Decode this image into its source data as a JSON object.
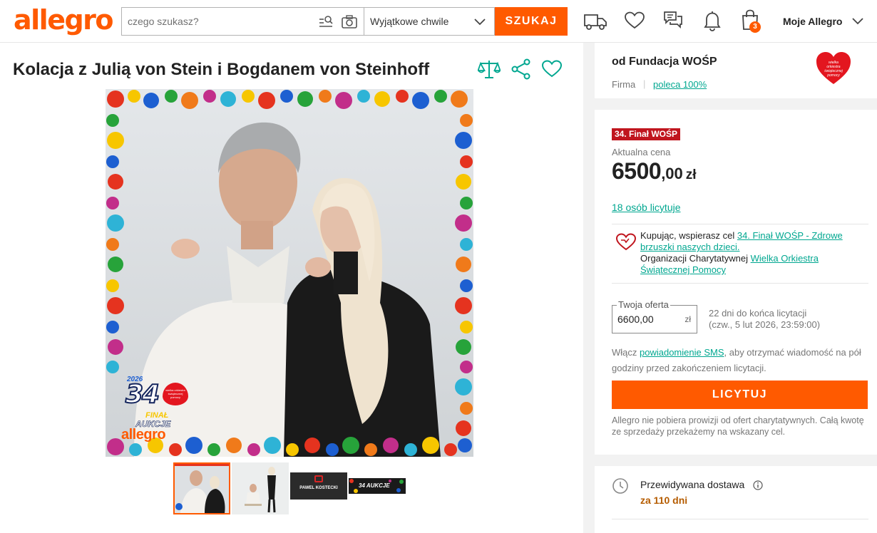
{
  "header": {
    "logo": "allegro",
    "search_placeholder": "czego szukasz?",
    "category": "Wyjątkowe chwile",
    "search_button": "SZUKAJ",
    "cart_count": "3",
    "account_label": "Moje Allegro"
  },
  "product": {
    "title": "Kolacja z Julią von Stein i Bogdanem von Steinhoff",
    "image_overlay": {
      "year": "2026",
      "number": "34",
      "line1": "FINAŁ",
      "line2": "AUKCJE",
      "brand": "allegro",
      "heart_text": "wielka orkiestra świątecznej pomocy"
    },
    "thumbnails": [
      {
        "name": "thumb-1"
      },
      {
        "name": "thumb-2"
      },
      {
        "name": "thumb-3",
        "text": "PAWEL KOSTECKI"
      },
      {
        "name": "thumb-4",
        "text": "34 AUKCJE"
      }
    ]
  },
  "seller": {
    "name": "od Fundacja WOŚP",
    "type": "Firma",
    "recommend": "poleca 100%",
    "logo_text": "wielka orkiestra świątecznej pomocy"
  },
  "offer": {
    "event_badge": "34. Finał WOŚP",
    "price_label": "Aktualna cena",
    "price_int": "6500",
    "price_dec": ",00",
    "price_currency": "zł",
    "bidders": "18 osób licytuje",
    "charity": {
      "prefix": "Kupując, wspierasz cel ",
      "cause": "34. Finał WOŚP - Zdrowe brzuszki naszych dzieci.",
      "org_prefix": "Organizacji Charytatywnej ",
      "org": "Wielka Orkiestra Świątecznej Pomocy"
    },
    "bid_label": "Twoja oferta",
    "bid_value": "6600,00",
    "bid_unit": "zł",
    "time_left": "22 dni do końca licytacji",
    "time_end": "(czw., 5 lut 2026, 23:59:00)",
    "sms_prefix": "Włącz ",
    "sms_link": "powiadomienie SMS",
    "sms_suffix": ", aby otrzymać wiadomość na pół godziny przed zakończeniem licytacji.",
    "bid_button": "LICYTUJ",
    "note": "Allegro nie pobiera prowizji od ofert charytatywnych. Całą kwotę ze sprzedaży przekażemy na wskazany cel."
  },
  "delivery": {
    "title": "Przewidywana dostawa",
    "value": "za 110 dni"
  },
  "colors": {
    "brand": "#ff5a00",
    "link": "#00a790",
    "badge": "#c0151e",
    "delivery": "#b55c00"
  }
}
